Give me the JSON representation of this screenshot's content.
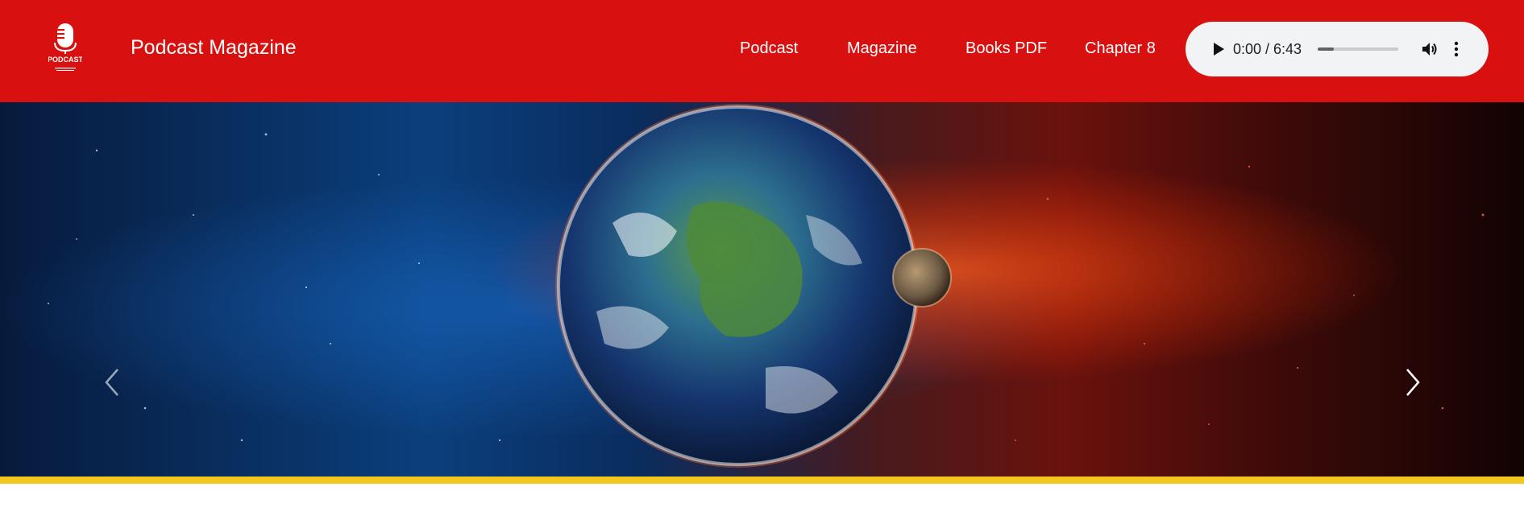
{
  "header": {
    "brand": "Podcast Magazine",
    "logo_text": "PODCAST",
    "background_color": "#d81010",
    "nav": [
      {
        "label": "Podcast"
      },
      {
        "label": "Magazine"
      },
      {
        "label": "Books PDF"
      },
      {
        "label": "Chapter 8"
      }
    ]
  },
  "player": {
    "time": "0:00 / 6:43",
    "progress_fraction": 0.2,
    "icons": [
      "play-icon",
      "volume-icon",
      "more-vertical-icon"
    ]
  },
  "carousel": {
    "image": "earth-and-moon-in-space",
    "prev_icon": "chevron-left-icon",
    "next_icon": "chevron-right-icon"
  },
  "accent": {
    "yellow": "#f2c81e",
    "red": "#d81010"
  }
}
